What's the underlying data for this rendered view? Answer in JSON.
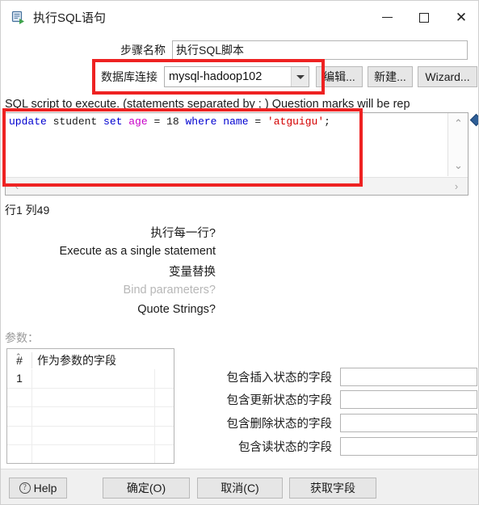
{
  "window": {
    "title": "执行SQL语句",
    "icon": "sql-execute-icon",
    "minimize_label": "",
    "maximize_label": "",
    "close_label": "✕"
  },
  "form": {
    "step_name_label": "步骤名称",
    "step_name_value": "执行SQL脚本",
    "step_name_placeholder": "",
    "connection_label": "数据库连接",
    "connection_value": "mysql-hadoop102",
    "edit_button": "编辑...",
    "new_button": "新建...",
    "wizard_button": "Wizard..."
  },
  "sql": {
    "label": "SQL script to execute. (statements separated by ; ) Question marks will be rep",
    "tokens": [
      {
        "t": "update",
        "c": "kw"
      },
      {
        "t": " student ",
        "c": "pl"
      },
      {
        "t": "set",
        "c": "kw"
      },
      {
        "t": " ",
        "c": "pl"
      },
      {
        "t": "age",
        "c": "col"
      },
      {
        "t": " = 18 ",
        "c": "pl"
      },
      {
        "t": "where",
        "c": "kw"
      },
      {
        "t": " ",
        "c": "pl"
      },
      {
        "t": "name",
        "c": "kw"
      },
      {
        "t": " = ",
        "c": "pl"
      },
      {
        "t": "'atguigu'",
        "c": "str"
      },
      {
        "t": ";",
        "c": "pl"
      }
    ],
    "scroll_up": "⌃",
    "scroll_down": "⌄",
    "scroll_left": "‹",
    "scroll_right": "›",
    "position_status": "行1 列49"
  },
  "options": [
    {
      "label": "执行每一行?",
      "disabled": false
    },
    {
      "label": "Execute as a single statement",
      "disabled": false
    },
    {
      "label": "变量替换",
      "disabled": false
    },
    {
      "label": "Bind parameters?",
      "disabled": true
    },
    {
      "label": "Quote Strings?",
      "disabled": false
    }
  ],
  "parameters": {
    "label": "参数：",
    "columns": [
      "#",
      "作为参数的字段"
    ],
    "sort_caret": "⌃",
    "rows": [
      {
        "num": "1",
        "field": ""
      },
      {
        "num": "",
        "field": ""
      },
      {
        "num": "",
        "field": ""
      },
      {
        "num": "",
        "field": ""
      },
      {
        "num": "",
        "field": ""
      }
    ]
  },
  "status_fields": [
    {
      "label": "包含插入状态的字段",
      "value": "",
      "placeholder": ""
    },
    {
      "label": "包含更新状态的字段",
      "value": "",
      "placeholder": ""
    },
    {
      "label": "包含删除状态的字段",
      "value": "",
      "placeholder": ""
    },
    {
      "label": "包含读状态的字段",
      "value": "",
      "placeholder": ""
    }
  ],
  "footer": {
    "help": "Help",
    "ok": "确定(O)",
    "cancel": "取消(C)",
    "get_fields": "获取字段"
  },
  "colors": {
    "annotation_red": "#ee2222",
    "keyword_blue": "#0000d0",
    "column_magenta": "#c800c8",
    "string_red": "#d40000",
    "marker_blue": "#2e5e96"
  }
}
